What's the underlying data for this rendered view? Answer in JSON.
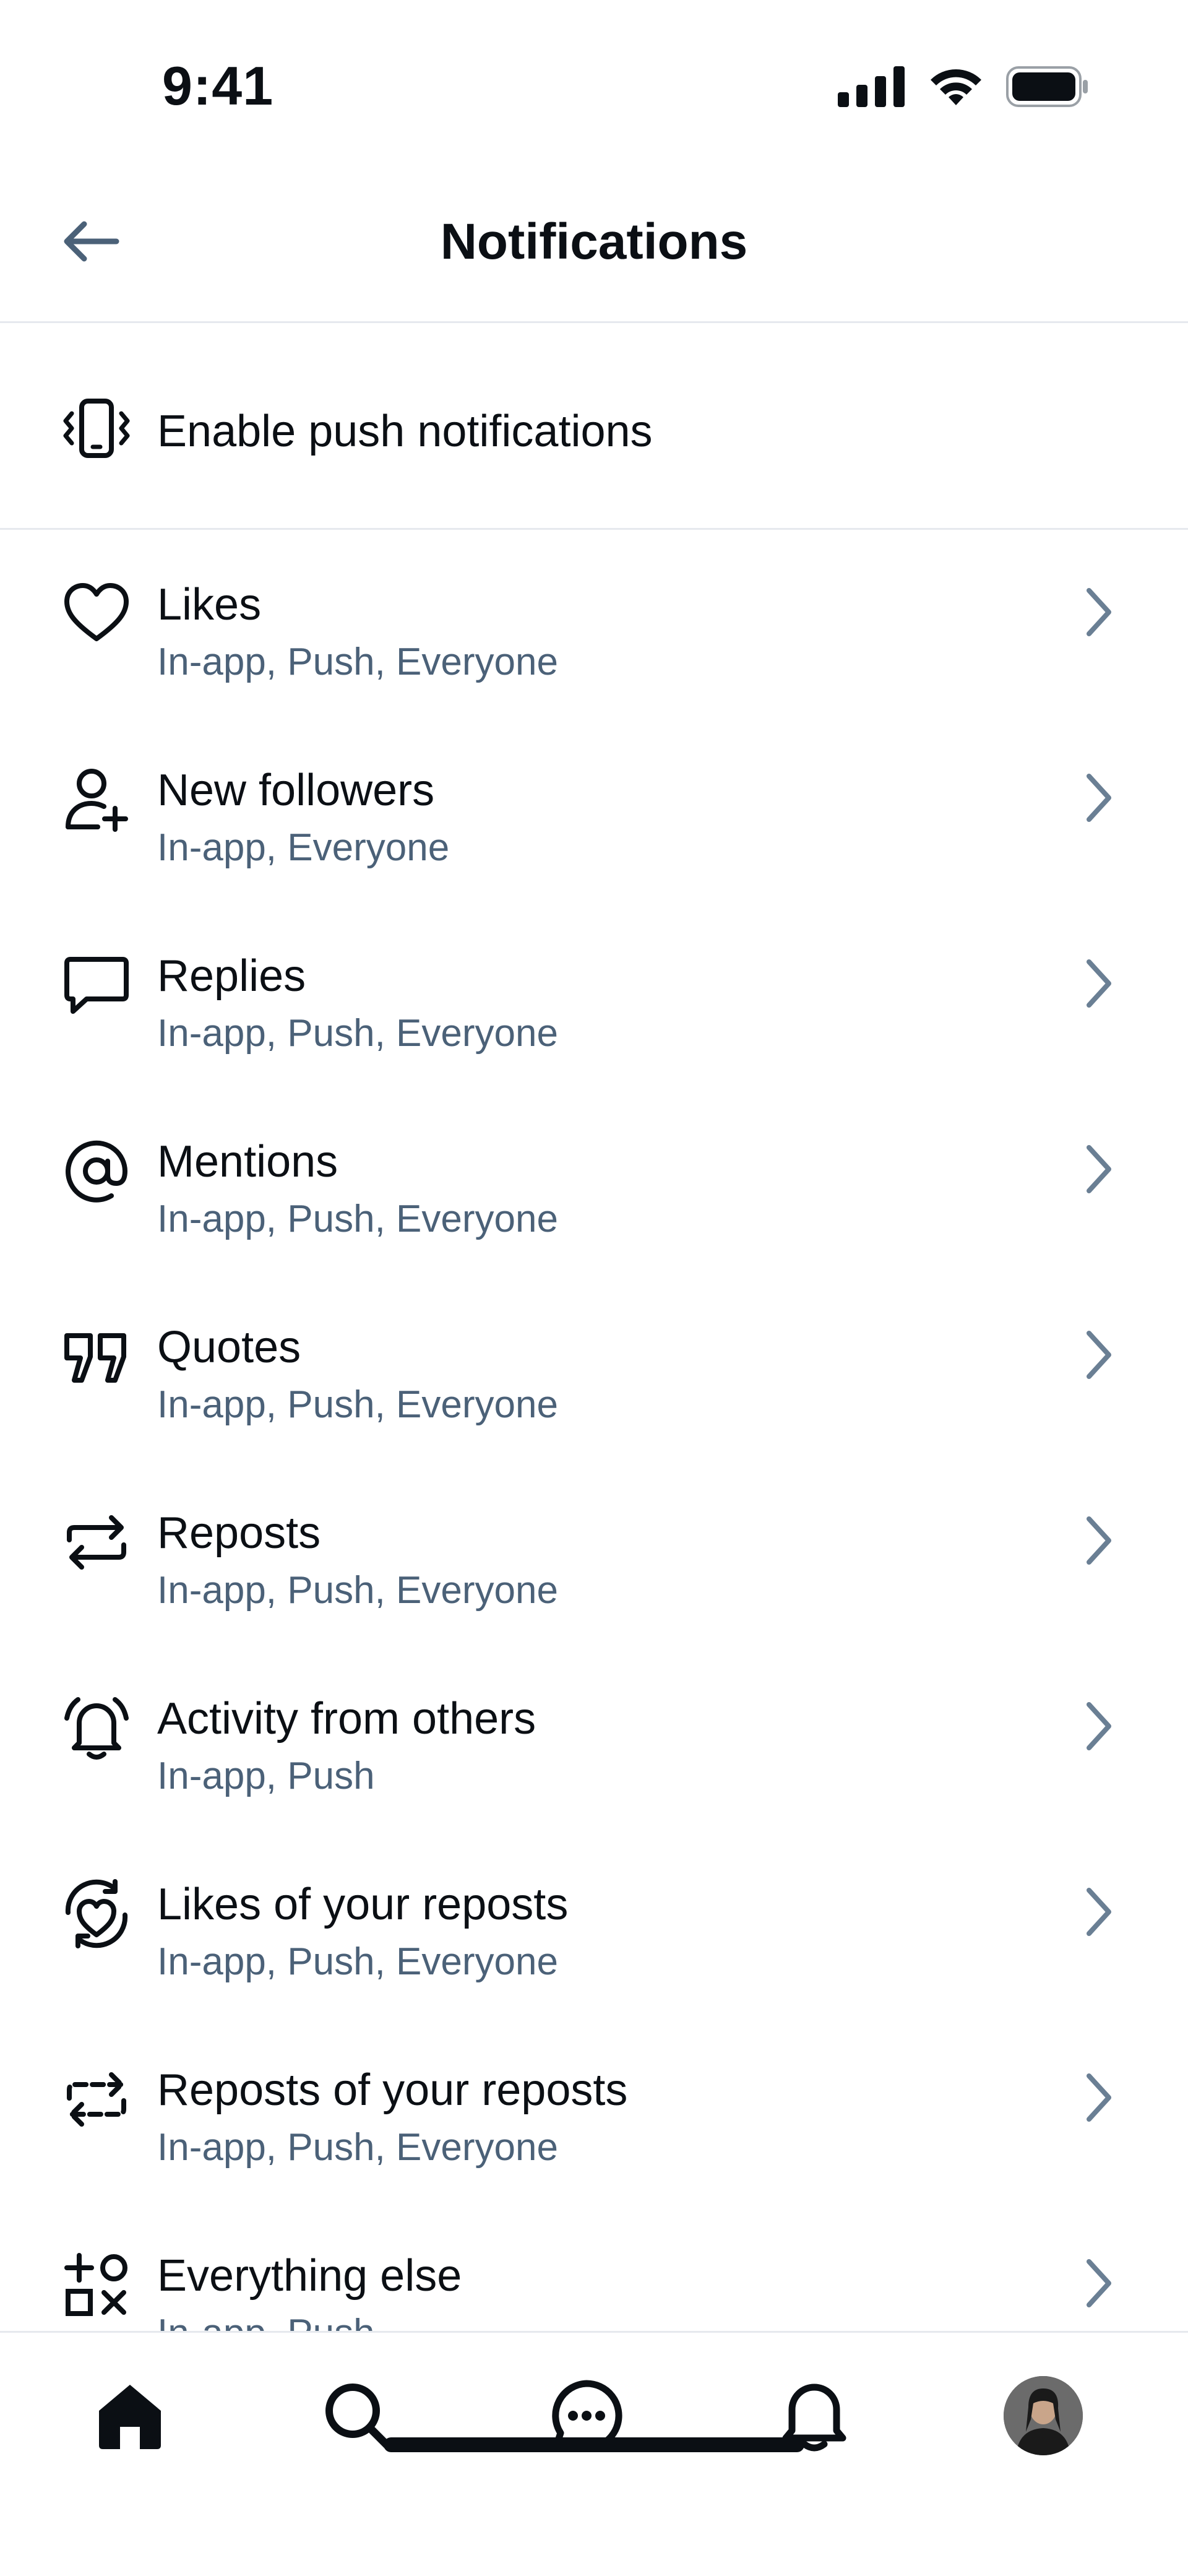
{
  "status_bar": {
    "time": "9:41"
  },
  "header": {
    "title": "Notifications"
  },
  "push": {
    "label": "Enable push notifications"
  },
  "items": [
    {
      "title": "Likes",
      "subtitle": "In-app, Push, Everyone",
      "icon": "heart-icon"
    },
    {
      "title": "New followers",
      "subtitle": "In-app, Everyone",
      "icon": "person-add-icon"
    },
    {
      "title": "Replies",
      "subtitle": "In-app, Push, Everyone",
      "icon": "speech-bubble-icon"
    },
    {
      "title": "Mentions",
      "subtitle": "In-app, Push, Everyone",
      "icon": "at-icon"
    },
    {
      "title": "Quotes",
      "subtitle": "In-app, Push, Everyone",
      "icon": "quote-icon"
    },
    {
      "title": "Reposts",
      "subtitle": "In-app, Push, Everyone",
      "icon": "repost-icon"
    },
    {
      "title": "Activity from others",
      "subtitle": "In-app, Push",
      "icon": "bell-ringing-icon"
    },
    {
      "title": "Likes of your reposts",
      "subtitle": "In-app, Push, Everyone",
      "icon": "heart-repost-icon"
    },
    {
      "title": "Reposts of your reposts",
      "subtitle": "In-app, Push, Everyone",
      "icon": "repost-dashed-icon"
    },
    {
      "title": "Everything else",
      "subtitle": "In-app, Push",
      "icon": "shapes-icon"
    }
  ],
  "tabbar": {
    "tabs": [
      "home-icon",
      "search-icon",
      "messages-icon",
      "notifications-icon",
      "profile-avatar"
    ]
  },
  "colors": {
    "text": "#0b0f14",
    "secondary": "#4b6178",
    "divider": "#e6e9ee"
  }
}
